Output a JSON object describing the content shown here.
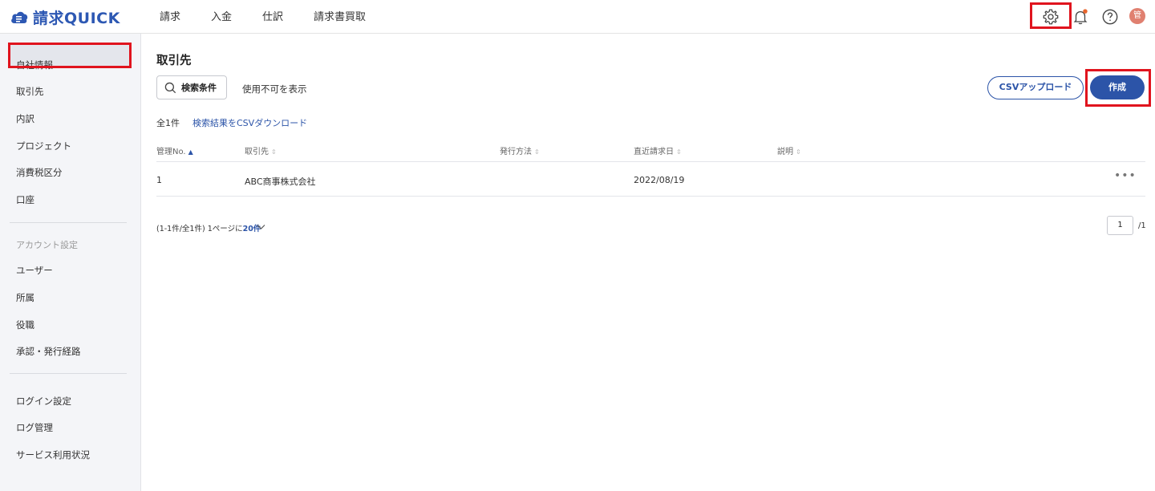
{
  "app": {
    "name": "請求QUICK"
  },
  "nav": [
    "請求",
    "入金",
    "仕訳",
    "請求書買取"
  ],
  "header_icons": {
    "settings": "gear-icon",
    "notifications": "bell-icon",
    "help": "help-icon",
    "avatar_text": "管",
    "accent": "#2c54a8",
    "notification_dot": "#e8662e",
    "highlight": "#e0141e"
  },
  "sidebar": {
    "items": [
      "自社情報",
      "取引先",
      "内訳",
      "プロジェクト",
      "消費税区分",
      "口座"
    ],
    "active": "取引先",
    "account_section": {
      "title": "アカウント設定",
      "items": [
        "ユーザー",
        "所属",
        "役職",
        "承認・発行経路"
      ]
    },
    "bottom_items": [
      "ログイン設定",
      "ログ管理",
      "サービス利用状況"
    ]
  },
  "main": {
    "title": "取引先",
    "search_button": "検索条件",
    "show_disabled": "使用不可を表示",
    "csv_upload": "CSVアップロード",
    "create": "作成",
    "count": "全1件",
    "csv_download": "検索結果をCSVダウンロード",
    "columns": [
      "管理No.",
      "取引先",
      "発行方法",
      "直近請求日",
      "説明"
    ],
    "rows": [
      {
        "no": "1",
        "partner": "ABC商事株式会社",
        "method": "",
        "last_date": "2022/08/19",
        "description": ""
      }
    ],
    "pagination": {
      "info": "(1-1件/全1件)",
      "per_page_label": "1ページに",
      "per_page": "20件",
      "page": "1",
      "total_pages": "/1"
    }
  }
}
